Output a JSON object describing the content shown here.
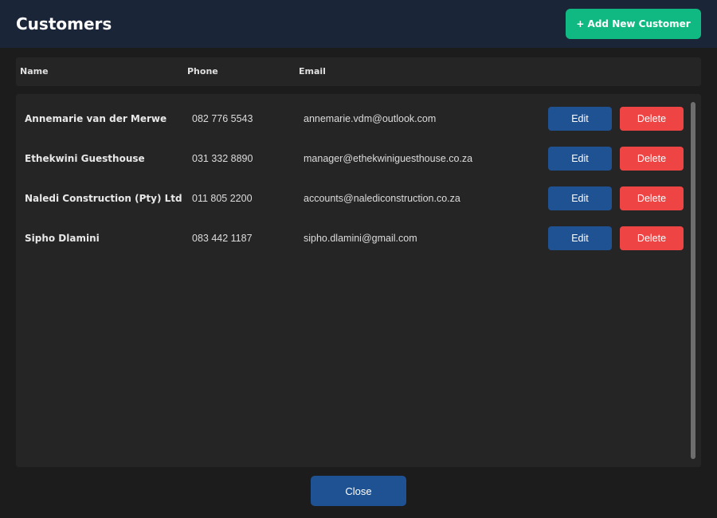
{
  "header": {
    "title": "Customers",
    "add_button_label": "+ Add New Customer"
  },
  "columns": {
    "name": "Name",
    "phone": "Phone",
    "email": "Email"
  },
  "customers": [
    {
      "name": "Annemarie van der Merwe",
      "phone": "082 776 5543",
      "email": "annemarie.vdm@outlook.com"
    },
    {
      "name": "Ethekwini Guesthouse",
      "phone": "031 332 8890",
      "email": "manager@ethekwiniguesthouse.co.za"
    },
    {
      "name": "Naledi Construction (Pty) Ltd",
      "phone": "011 805 2200",
      "email": "accounts@nalediconstruction.co.za"
    },
    {
      "name": "Sipho Dlamini",
      "phone": "083 442 1187",
      "email": "sipho.dlamini@gmail.com"
    }
  ],
  "row_actions": {
    "edit_label": "Edit",
    "delete_label": "Delete"
  },
  "footer": {
    "close_label": "Close"
  },
  "colors": {
    "header_bg": "#1b2538",
    "add_button": "#10b981",
    "edit_button": "#1f5293",
    "delete_button": "#ef4444",
    "close_button": "#1f5293"
  }
}
